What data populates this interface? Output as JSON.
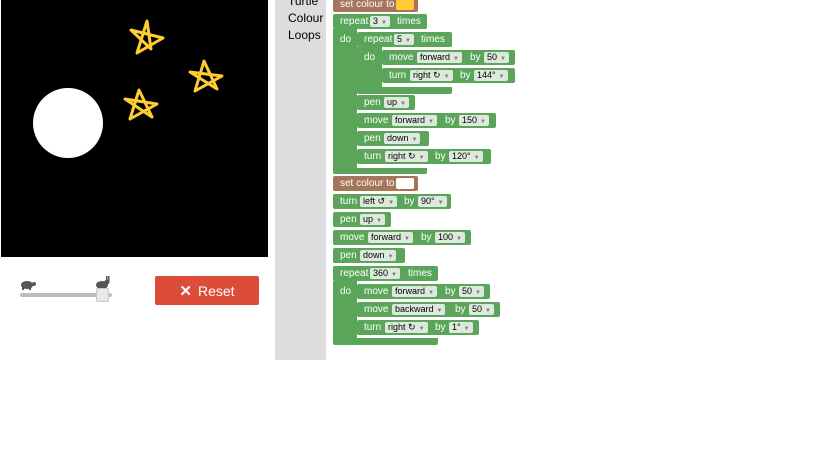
{
  "speed": {
    "slow_icon": "turtle-icon",
    "fast_icon": "rabbit-icon",
    "position": 1.0
  },
  "reset": {
    "label": "Reset",
    "icon": "close-icon"
  },
  "toolbox": {
    "categories": [
      "Turtle",
      "Colour",
      "Loops"
    ]
  },
  "colors": {
    "star": "#ffcc33",
    "circle": "#ffffff",
    "loop_block": "#5ba55b",
    "colour_block": "#a5745b",
    "reset_button": "#dd4b39"
  },
  "program": {
    "c1": {
      "label": "set colour to",
      "swatch": "#ffcc33"
    },
    "r1": {
      "label": "repeat",
      "value": "3",
      "times": "times",
      "do": "do"
    },
    "r2": {
      "label": "repeat",
      "value": "5",
      "times": "times",
      "do": "do"
    },
    "m1": {
      "label": "move",
      "dir": "forward",
      "by": "by",
      "value": "50"
    },
    "t1": {
      "label": "turn",
      "dir": "right ↻",
      "by": "by",
      "value": "144°"
    },
    "p1": {
      "label": "pen",
      "value": "up"
    },
    "m2": {
      "label": "move",
      "dir": "forward",
      "by": "by",
      "value": "150"
    },
    "p2": {
      "label": "pen",
      "value": "down"
    },
    "t2": {
      "label": "turn",
      "dir": "right ↻",
      "by": "by",
      "value": "120°"
    },
    "c2": {
      "label": "set colour to",
      "swatch": "#ffffff"
    },
    "t3": {
      "label": "turn",
      "dir": "left ↺",
      "by": "by",
      "value": "90°"
    },
    "p3": {
      "label": "pen",
      "value": "up"
    },
    "m3": {
      "label": "move",
      "dir": "forward",
      "by": "by",
      "value": "100"
    },
    "p4": {
      "label": "pen",
      "value": "down"
    },
    "r3": {
      "label": "repeat",
      "value": "360",
      "times": "times",
      "do": "do"
    },
    "m4": {
      "label": "move",
      "dir": "forward",
      "by": "by",
      "value": "50"
    },
    "m5": {
      "label": "move",
      "dir": "backward",
      "by": "by",
      "value": "50"
    },
    "t4": {
      "label": "turn",
      "dir": "right ↻",
      "by": "by",
      "value": "1°"
    }
  }
}
